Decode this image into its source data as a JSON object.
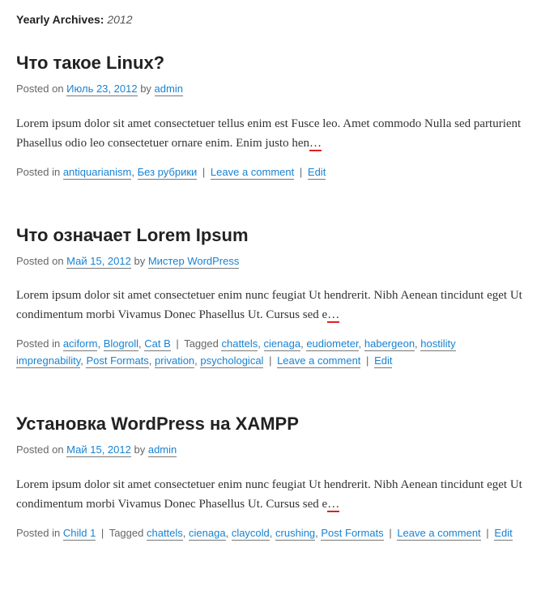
{
  "archive": {
    "label": "Yearly Archives:",
    "year": "2012"
  },
  "labels": {
    "posted_on": "Posted on",
    "by": "by",
    "posted_in": "Posted in",
    "tagged": "Tagged",
    "leave_comment": "Leave a comment",
    "edit": "Edit",
    "sep": "|",
    "cat_sep": ", "
  },
  "posts": [
    {
      "title": "Что такое Linux?",
      "date": "Июль 23, 2012",
      "author": "admin",
      "excerpt": "Lorem ipsum dolor sit amet consectetuer tellus enim est Fusce leo. Amet commodo Nulla sed parturient Phasellus odio leo consectetuer ornare enim. Enim justo hen",
      "more": "…",
      "categories": [
        "antiquarianism",
        "Без рубрики"
      ],
      "tags": []
    },
    {
      "title": "Что означает Lorem Ipsum",
      "date": "Май 15, 2012",
      "author": "Мистер WordPress",
      "excerpt": "Lorem ipsum dolor sit amet consectetuer enim nunc feugiat Ut hendrerit. Nibh Aenean tincidunt eget Ut condimentum morbi Vivamus Donec Phasellus Ut. Cursus sed e",
      "more": "…",
      "categories": [
        "aciform",
        "Blogroll",
        "Cat B"
      ],
      "tags": [
        "chattels",
        "cienaga",
        "eudiometer",
        "habergeon",
        "hostility impregnability",
        "Post Formats",
        "privation",
        "psychological"
      ]
    },
    {
      "title": "Установка WordPress на XAMPP",
      "date": "Май 15, 2012",
      "author": "admin",
      "excerpt": "Lorem ipsum dolor sit amet consectetuer enim nunc feugiat Ut hendrerit. Nibh Aenean tincidunt eget Ut condimentum morbi Vivamus Donec Phasellus Ut. Cursus sed e",
      "more": "…",
      "categories": [
        "Child 1"
      ],
      "tags": [
        "chattels",
        "cienaga",
        "claycold",
        "crushing",
        "Post Formats"
      ]
    }
  ]
}
